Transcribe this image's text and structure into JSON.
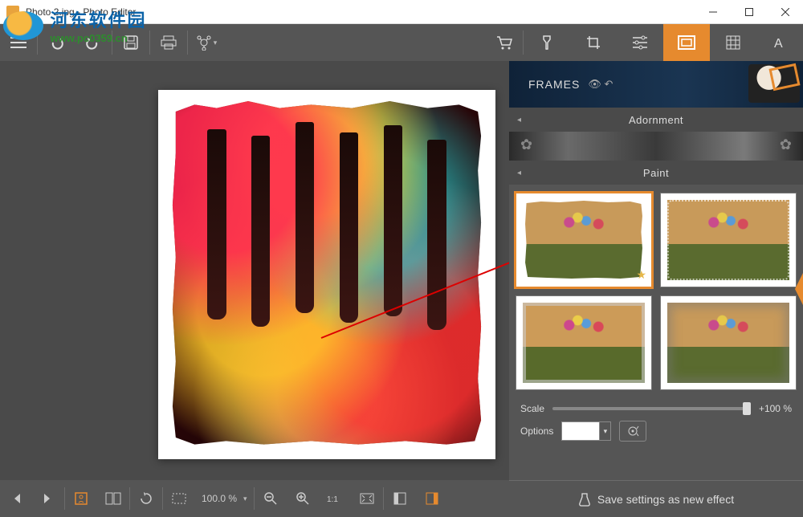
{
  "titlebar": {
    "title": "Photo 2.jpg - Photo Editor"
  },
  "watermark": {
    "cn": "河东软件园",
    "url": "www.pc0359.cn"
  },
  "toolbar": {
    "undo": "undo",
    "redo": "redo",
    "save": "save",
    "print": "print",
    "share": "share",
    "cart": "cart"
  },
  "right_tabs": [
    "flask",
    "crop",
    "sliders",
    "frames",
    "texture",
    "text"
  ],
  "panel": {
    "header": "FRAMES",
    "sections": {
      "adornment": "Adornment",
      "paint": "Paint"
    },
    "scale": {
      "label": "Scale",
      "value_text": "+100 %",
      "value": 100
    },
    "options": {
      "label": "Options",
      "color": "#ffffff"
    },
    "save_effect": "Save settings as new effect"
  },
  "bottombar": {
    "zoom_text": "100.0 %"
  }
}
